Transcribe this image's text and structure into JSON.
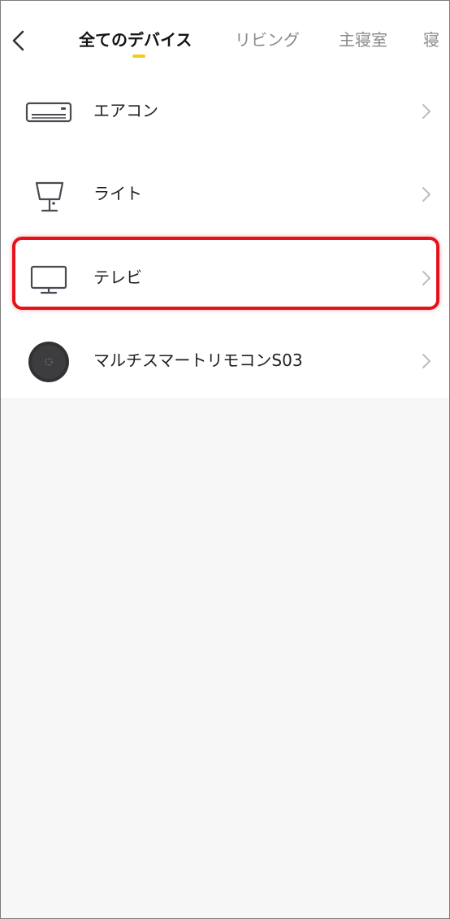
{
  "header": {
    "back_icon": "chevron-left-icon",
    "tabs": [
      {
        "label": "全てのデバイス",
        "active": true
      },
      {
        "label": "リビング",
        "active": false
      },
      {
        "label": "主寝室",
        "active": false
      },
      {
        "label": "寝",
        "active": false
      }
    ],
    "indicator_color": "#f2cc1d"
  },
  "devices": [
    {
      "label": "エアコン",
      "icon": "air-conditioner-icon"
    },
    {
      "label": "ライト",
      "icon": "lamp-icon"
    },
    {
      "label": "テレビ",
      "icon": "tv-icon"
    },
    {
      "label": "マルチスマートリモコンS03",
      "icon": "smart-remote-hub-icon"
    }
  ],
  "highlight": {
    "target": "テレビ",
    "color": "#e5121b"
  }
}
